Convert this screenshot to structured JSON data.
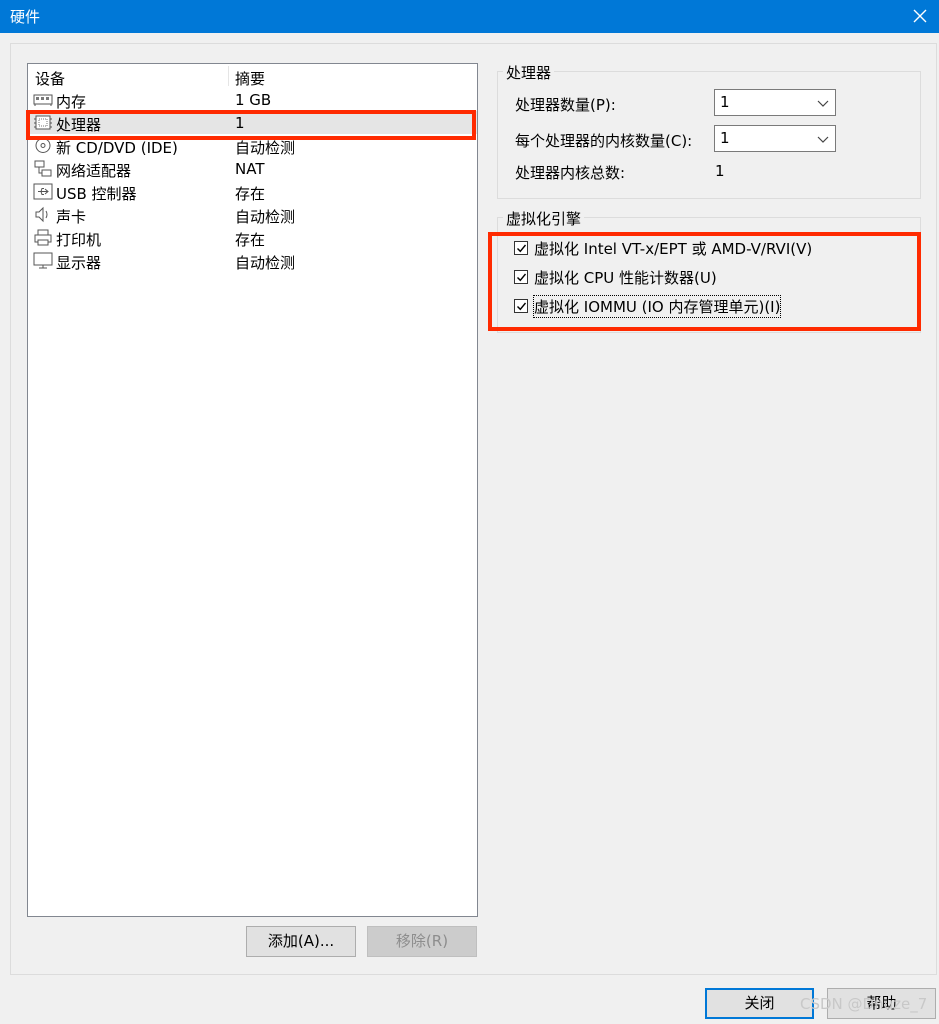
{
  "window": {
    "title": "硬件"
  },
  "device_list": {
    "headers": {
      "device": "设备",
      "summary": "摘要"
    },
    "items": [
      {
        "name": "内存",
        "summary": "1 GB",
        "icon": "memory-icon"
      },
      {
        "name": "处理器",
        "summary": "1",
        "icon": "processor-icon"
      },
      {
        "name": "新 CD/DVD (IDE)",
        "summary": "自动检测",
        "icon": "cd-dvd-icon"
      },
      {
        "name": "网络适配器",
        "summary": "NAT",
        "icon": "network-adapter-icon"
      },
      {
        "name": "USB 控制器",
        "summary": "存在",
        "icon": "usb-icon"
      },
      {
        "name": "声卡",
        "summary": "自动检测",
        "icon": "speaker-icon"
      },
      {
        "name": "打印机",
        "summary": "存在",
        "icon": "printer-icon"
      },
      {
        "name": "显示器",
        "summary": "自动检测",
        "icon": "monitor-icon"
      }
    ],
    "selected": "处理器"
  },
  "buttons": {
    "add": "添加(A)...",
    "remove": "移除(R)",
    "close": "关闭",
    "help": "帮助"
  },
  "processor_group": {
    "label": "处理器",
    "num_processors_label": "处理器数量(P):",
    "num_processors_value": "1",
    "cores_per_processor_label": "每个处理器的内核数量(C):",
    "cores_per_processor_value": "1",
    "total_cores_label": "处理器内核总数:",
    "total_cores_value": "1"
  },
  "virtualization_group": {
    "label": "虚拟化引擎",
    "options": [
      {
        "label": "虚拟化 Intel VT-x/EPT 或 AMD-V/RVI(V)",
        "checked": true
      },
      {
        "label": "虚拟化 CPU 性能计数器(U)",
        "checked": true
      },
      {
        "label": "虚拟化 IOMMU (IO 内存管理单元)(I)",
        "checked": true
      }
    ]
  },
  "colors": {
    "titlebar": "#0078d7",
    "highlight": "#ff2a00"
  },
  "watermark": "CSDN @Dnuze_7"
}
